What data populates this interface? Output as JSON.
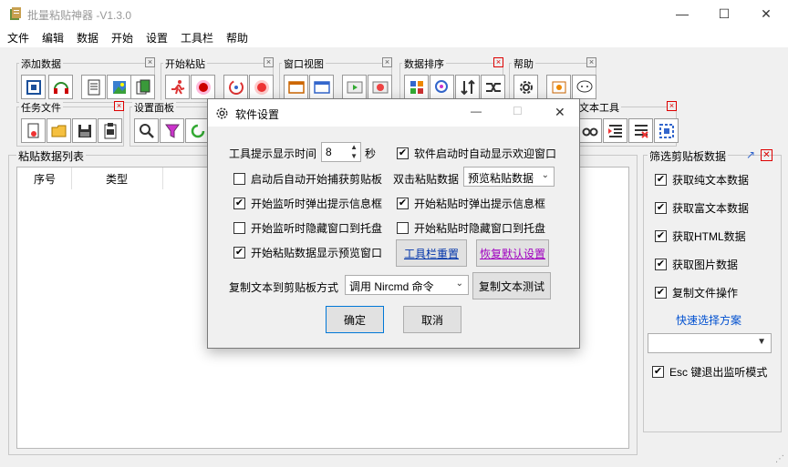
{
  "window": {
    "title": "批量粘贴神器   -V1.3.0",
    "min": "—",
    "max": "☐",
    "close": "✕"
  },
  "menu": [
    "文件",
    "编辑",
    "数据",
    "开始",
    "设置",
    "工具栏",
    "帮助"
  ],
  "toolbars": {
    "add_data": "添加数据",
    "start_paste": "开始粘贴",
    "window_view": "窗口视图",
    "data_sort": "数据排序",
    "help": "帮助",
    "task_file": "任务文件",
    "settings_panel": "设置面板",
    "text_tools": "文本工具",
    "close_glyph": "×"
  },
  "list_panel": {
    "title": "粘贴数据列表",
    "columns": [
      "序号",
      "类型"
    ]
  },
  "filter_panel": {
    "title": "筛选剪贴板数据",
    "pin_glyph": "↗",
    "close_glyph": "✕",
    "options": [
      {
        "label": "获取纯文本数据",
        "checked": true
      },
      {
        "label": "获取富文本数据",
        "checked": true
      },
      {
        "label": "获取HTML数据",
        "checked": true
      },
      {
        "label": "获取图片数据",
        "checked": true
      },
      {
        "label": "复制文件操作",
        "checked": true
      }
    ],
    "quick_link": "快速选择方案",
    "scheme_value": "",
    "esc_label": "Esc 键退出监听模式",
    "esc_checked": true
  },
  "dialog": {
    "title": "软件设置",
    "tooltip_label": "工具提示显示时间",
    "tooltip_value": "8",
    "tooltip_unit": "秒",
    "startup_welcome": "软件启动时自动显示欢迎窗口",
    "startup_welcome_checked": true,
    "auto_capture": "启动后自动开始捕获剪贴板",
    "auto_capture_checked": false,
    "dblclick_label": "双击粘贴数据",
    "dblclick_value": "预览粘贴数据",
    "monitor_popup": "开始监听时弹出提示信息框",
    "monitor_popup_checked": true,
    "paste_popup": "开始粘贴时弹出提示信息框",
    "paste_popup_checked": true,
    "monitor_tray": "开始监听时隐藏窗口到托盘",
    "monitor_tray_checked": false,
    "paste_tray": "开始粘贴时隐藏窗口到托盘",
    "paste_tray_checked": false,
    "preview_window": "开始粘贴数据显示预览窗口",
    "preview_window_checked": true,
    "toolbar_reset": "工具栏重置",
    "restore_default": "恢复默认设置",
    "copy_method_label": "复制文本到剪贴板方式",
    "copy_method_value": "调用 Nircmd 命令",
    "copy_test": "复制文本测试",
    "ok": "确定",
    "cancel": "取消",
    "check_glyph": "✔",
    "min": "—",
    "max": "☐",
    "close": "✕"
  }
}
